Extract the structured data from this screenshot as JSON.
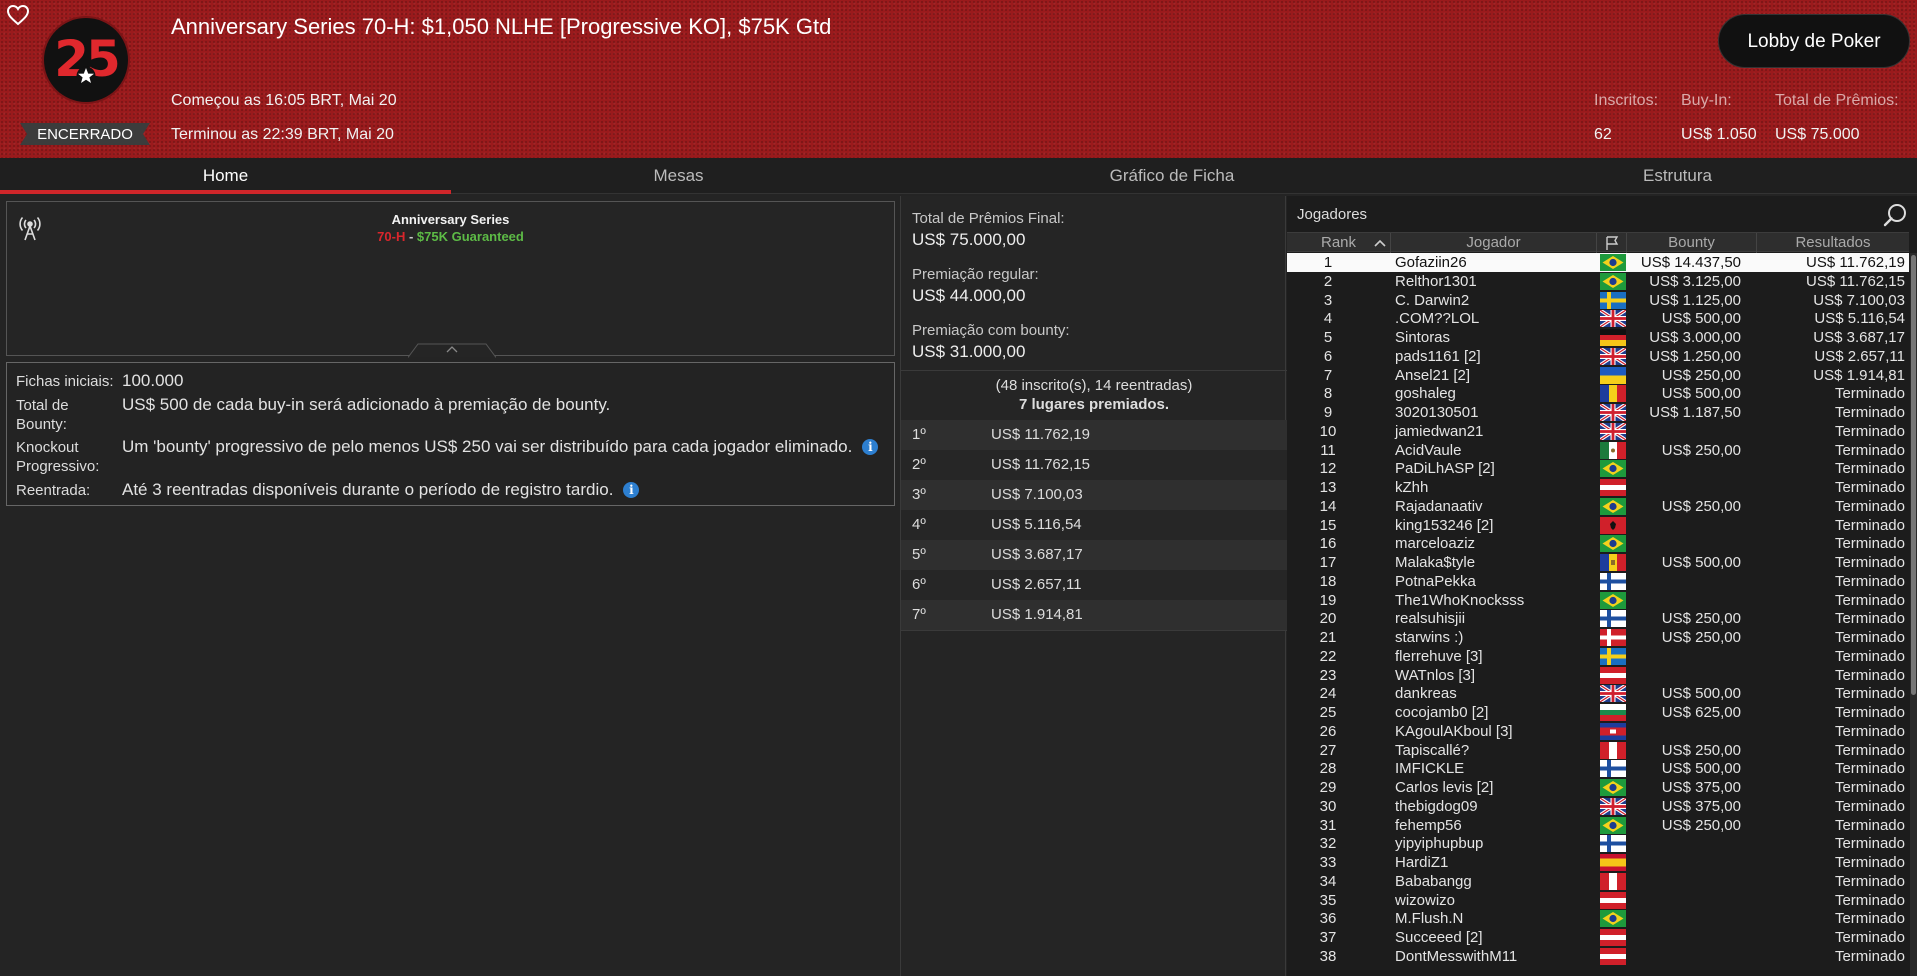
{
  "header": {
    "title": "Anniversary Series 70-H: $1,050 NLHE [Progressive KO], $75K Gtd",
    "logo_text": "25",
    "status": "ENCERRADO",
    "started": "Começou as 16:05 BRT, Mai 20",
    "ended": "Terminou as 22:39 BRT, Mai 20",
    "lobby_button": "Lobby de Poker",
    "stats": [
      {
        "label": "Inscritos:",
        "value": "62"
      },
      {
        "label": "Buy-In:",
        "value": "US$ 1.050"
      },
      {
        "label": "Total de Prêmios:",
        "value": "US$ 75.000"
      }
    ]
  },
  "tabs": [
    "Home",
    "Mesas",
    "Gráfico de Ficha",
    "Estrutura"
  ],
  "banner": {
    "title": "Anniversary Series",
    "event_code": "70-H",
    "separator": " - ",
    "guarantee": "$75K Guaranteed"
  },
  "info": {
    "starting_chips_label": "Fichas iniciais:",
    "starting_chips_value": "100.000",
    "bounty_label": "Total de Bounty:",
    "bounty_value": "US$ 500 de cada buy-in será adicionado à premiação de bounty.",
    "pko_label": "Knockout Progressivo:",
    "pko_value": "Um 'bounty' progressivo de pelo menos US$ 250 vai ser distribuído para cada jogador eliminado.",
    "reentry_label": "Reentrada:",
    "reentry_value": "Até 3 reentradas disponíveis durante o período de registro tardio.",
    "info_glyph": "i"
  },
  "prizes": {
    "total_label": "Total de Prêmios Final:",
    "total_value": "US$ 75.000,00",
    "regular_label": "Premiação regular:",
    "regular_value": "US$ 44.000,00",
    "bounty_label": "Premiação com bounty:",
    "bounty_value": "US$ 31.000,00",
    "entrants": "(48 inscrito(s), 14 reentradas)",
    "places": "7 lugares premiados.",
    "rows": [
      {
        "pos": "1º",
        "amount": "US$ 11.762,19"
      },
      {
        "pos": "2º",
        "amount": "US$ 11.762,15"
      },
      {
        "pos": "3º",
        "amount": "US$ 7.100,03"
      },
      {
        "pos": "4º",
        "amount": "US$ 5.116,54"
      },
      {
        "pos": "5º",
        "amount": "US$ 3.687,17"
      },
      {
        "pos": "6º",
        "amount": "US$ 2.657,11"
      },
      {
        "pos": "7º",
        "amount": "US$ 1.914,81"
      }
    ]
  },
  "players": {
    "title": "Jogadores",
    "columns": {
      "rank": "Rank",
      "player": "Jogador",
      "bounty": "Bounty",
      "results": "Resultados"
    },
    "rows": [
      {
        "rank": "1",
        "name": "Gofaziin26",
        "flag": "br",
        "bounty": "US$ 14.437,50",
        "result": "US$ 11.762,19"
      },
      {
        "rank": "2",
        "name": "Relthor1301",
        "flag": "br",
        "bounty": "US$ 3.125,00",
        "result": "US$ 11.762,15"
      },
      {
        "rank": "3",
        "name": "C. Darwin2",
        "flag": "se",
        "bounty": "US$ 1.125,00",
        "result": "US$ 7.100,03"
      },
      {
        "rank": "4",
        "name": ".COM??LOL",
        "flag": "gb",
        "bounty": "US$ 500,00",
        "result": "US$ 5.116,54"
      },
      {
        "rank": "5",
        "name": "Sintoras",
        "flag": "de",
        "bounty": "US$ 3.000,00",
        "result": "US$ 3.687,17"
      },
      {
        "rank": "6",
        "name": "pads1161 [2]",
        "flag": "gb",
        "bounty": "US$ 1.250,00",
        "result": "US$ 2.657,11"
      },
      {
        "rank": "7",
        "name": "Ansel21 [2]",
        "flag": "ua",
        "bounty": "US$ 250,00",
        "result": "US$ 1.914,81"
      },
      {
        "rank": "8",
        "name": "goshaleg",
        "flag": "ro",
        "bounty": "US$ 500,00",
        "result": "Terminado"
      },
      {
        "rank": "9",
        "name": "3020130501",
        "flag": "gb",
        "bounty": "US$ 1.187,50",
        "result": "Terminado"
      },
      {
        "rank": "10",
        "name": "jamiedwan21",
        "flag": "gb",
        "bounty": "",
        "result": "Terminado"
      },
      {
        "rank": "11",
        "name": "AcidVaule",
        "flag": "mx",
        "bounty": "US$ 250,00",
        "result": "Terminado"
      },
      {
        "rank": "12",
        "name": "PaDiLhASP [2]",
        "flag": "br",
        "bounty": "",
        "result": "Terminado"
      },
      {
        "rank": "13",
        "name": "kZhh",
        "flag": "at",
        "bounty": "",
        "result": "Terminado"
      },
      {
        "rank": "14",
        "name": "Rajadanaativ",
        "flag": "br",
        "bounty": "US$ 250,00",
        "result": "Terminado"
      },
      {
        "rank": "15",
        "name": "king153246 [2]",
        "flag": "al",
        "bounty": "",
        "result": "Terminado"
      },
      {
        "rank": "16",
        "name": "marceloaziz",
        "flag": "br",
        "bounty": "",
        "result": "Terminado"
      },
      {
        "rank": "17",
        "name": "Malaka$tyle",
        "flag": "md",
        "bounty": "US$ 500,00",
        "result": "Terminado"
      },
      {
        "rank": "18",
        "name": "PotnaPekka",
        "flag": "fi",
        "bounty": "",
        "result": "Terminado"
      },
      {
        "rank": "19",
        "name": "The1WhoKnocksss",
        "flag": "br",
        "bounty": "",
        "result": "Terminado"
      },
      {
        "rank": "20",
        "name": "realsuhisjii",
        "flag": "fi",
        "bounty": "US$ 250,00",
        "result": "Terminado"
      },
      {
        "rank": "21",
        "name": "starwins :)",
        "flag": "dk",
        "bounty": "US$ 250,00",
        "result": "Terminado"
      },
      {
        "rank": "22",
        "name": "flerrehuve [3]",
        "flag": "se",
        "bounty": "",
        "result": "Terminado"
      },
      {
        "rank": "23",
        "name": "WATnlos [3]",
        "flag": "at",
        "bounty": "",
        "result": "Terminado"
      },
      {
        "rank": "24",
        "name": "dankreas",
        "flag": "gb",
        "bounty": "US$ 500,00",
        "result": "Terminado"
      },
      {
        "rank": "25",
        "name": "cocojamb0 [2]",
        "flag": "bg",
        "bounty": "US$ 625,00",
        "result": "Terminado"
      },
      {
        "rank": "26",
        "name": "KAgoulAKboul [3]",
        "flag": "kh",
        "bounty": "",
        "result": "Terminado"
      },
      {
        "rank": "27",
        "name": "Tapiscallé?",
        "flag": "pe",
        "bounty": "US$ 250,00",
        "result": "Terminado"
      },
      {
        "rank": "28",
        "name": "IMFICKLE",
        "flag": "fi",
        "bounty": "US$ 500,00",
        "result": "Terminado"
      },
      {
        "rank": "29",
        "name": "Carlos levis [2]",
        "flag": "br",
        "bounty": "US$ 375,00",
        "result": "Terminado"
      },
      {
        "rank": "30",
        "name": "thebigdog09",
        "flag": "gb",
        "bounty": "US$ 375,00",
        "result": "Terminado"
      },
      {
        "rank": "31",
        "name": "fehemp56",
        "flag": "br",
        "bounty": "US$ 250,00",
        "result": "Terminado"
      },
      {
        "rank": "32",
        "name": "yipyiphupbup",
        "flag": "fi",
        "bounty": "",
        "result": "Terminado"
      },
      {
        "rank": "33",
        "name": "HardiZ1",
        "flag": "es",
        "bounty": "",
        "result": "Terminado"
      },
      {
        "rank": "34",
        "name": "Bababangg",
        "flag": "pe",
        "bounty": "",
        "result": "Terminado"
      },
      {
        "rank": "35",
        "name": "wizowizo",
        "flag": "at",
        "bounty": "",
        "result": "Terminado"
      },
      {
        "rank": "36",
        "name": "M.Flush.N",
        "flag": "br",
        "bounty": "",
        "result": "Terminado"
      },
      {
        "rank": "37",
        "name": "Succeeed [2]",
        "flag": "at",
        "bounty": "",
        "result": "Terminado"
      },
      {
        "rank": "38",
        "name": "DontMesswithM11",
        "flag": "at",
        "bounty": "",
        "result": "Terminado"
      }
    ]
  },
  "colors": {
    "header_red": "#9a1a1c",
    "accent_red": "#d0262a",
    "banner_green": "#5dbb46",
    "info_blue": "#2d7fd0"
  },
  "icons": {
    "heart": "heart-icon",
    "search": "search-icon",
    "antenna": "antenna-icon",
    "flag_column": "flag-icon",
    "sort": "chevron-up-icon"
  }
}
